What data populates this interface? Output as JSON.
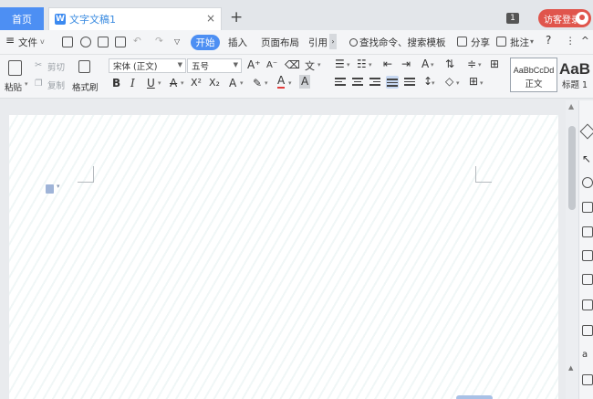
{
  "tabs": {
    "home_label": "首页",
    "doc_label": "文字文稿1",
    "doc_logo": "W",
    "close_glyph": "×",
    "add_glyph": "+"
  },
  "titlebar": {
    "badge": "1",
    "login_label": "访客登录"
  },
  "menu": {
    "file_label": "文件",
    "active_tab": "开始",
    "items": [
      "插入",
      "页面布局",
      "引用"
    ],
    "search_label": "查找命令、搜索模板",
    "share_label": "分享",
    "comment_label": "批注",
    "help_glyph": "?",
    "more_glyph": "⋮",
    "collapse_glyph": "^"
  },
  "ribbon": {
    "paste_label": "粘贴",
    "cut_label": "剪切",
    "copy_label": "复制",
    "format_painter_label": "格式刷",
    "font_name": "宋体 (正文)",
    "font_size": "五号",
    "bold": "B",
    "italic": "I",
    "underline": "U",
    "strike": "A",
    "superscript": "X²",
    "subscript": "X₂",
    "text_effect": "A",
    "font_color": "A",
    "char_shade": "A",
    "grow_font": "A⁺",
    "shrink_font": "A⁻",
    "styles": [
      {
        "sample": "AaBbCcDd",
        "name": "正文"
      },
      {
        "sample": "AaB",
        "name": "标题 1"
      }
    ]
  },
  "colors": {
    "accent": "#4d8ff3",
    "login": "#e0554c",
    "tab_text": "#3a8be0"
  }
}
